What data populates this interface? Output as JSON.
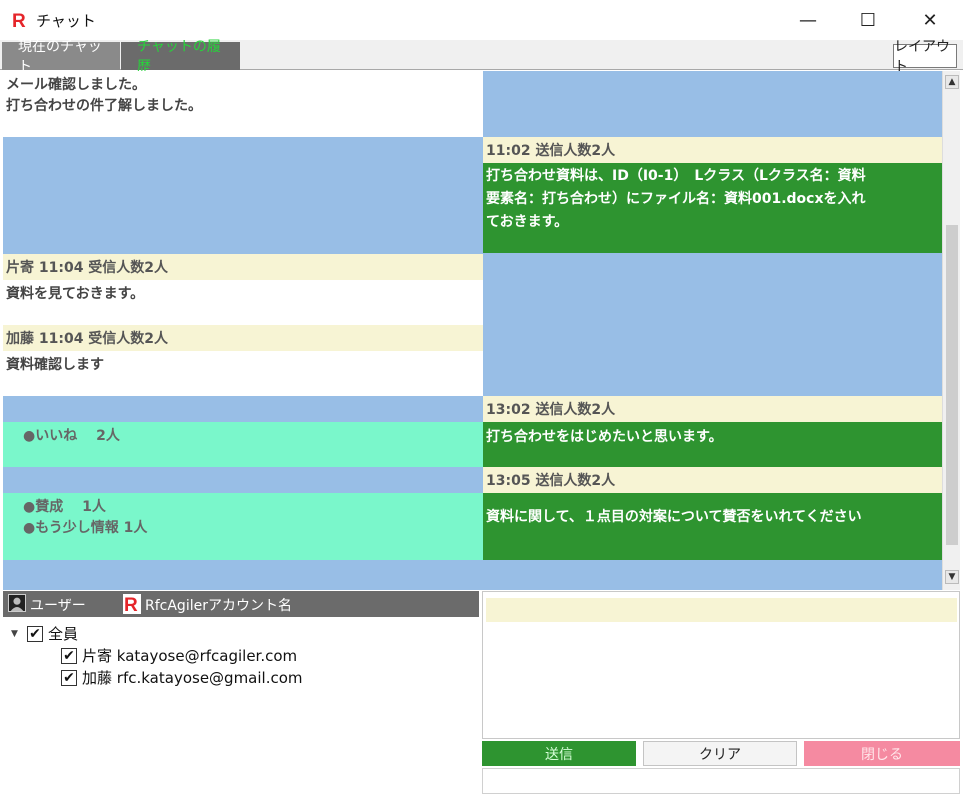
{
  "window": {
    "title": "チャット",
    "min_symbol": "—",
    "max_symbol": "☐",
    "close_symbol": "✕",
    "logo_letter": "R"
  },
  "tabs": [
    {
      "label": "現在のチャット"
    },
    {
      "label": "チャットの履歴"
    }
  ],
  "layout_button": "レイアウト",
  "messages": {
    "m1": {
      "lines": [
        "メール確認しました。",
        "打ち合わせの件了解しました。"
      ]
    },
    "m2": {
      "header": "11:02  送信人数2人",
      "lines": [
        "打ち合わせ資料は、ID（I0-1）　Lクラス（Lクラス名：資料",
        "要素名：打ち合わせ）にファイル名：資料001.docxを入れ",
        "ておきます。"
      ]
    },
    "m3": {
      "header": "片寄  11:04  受信人数2人",
      "lines": [
        "資料を見ておきます。"
      ]
    },
    "m4": {
      "header": "加藤  11:04  受信人数2人",
      "lines": [
        "資料確認します"
      ]
    },
    "m5": {
      "header": "13:02  送信人数2人",
      "lines": [
        "打ち合わせをはじめたいと思います。"
      ],
      "reactions": [
        "●いいね　 2人"
      ]
    },
    "m6": {
      "header": "13:05  送信人数2人",
      "lines": [
        "資料に関して、１点目の対案について賛否をいれてください"
      ],
      "reactions": [
        "●賛成　 1人",
        "●もう少し情報  1人"
      ]
    }
  },
  "users_panel": {
    "user_header": "ユーザー",
    "account_header": "RfcAgilerアカウント名",
    "all_label": "全員",
    "members": [
      {
        "name": "片寄",
        "email": "katayose@rfcagiler.com"
      },
      {
        "name": "加藤",
        "email": "rfc.katayose@gmail.com"
      }
    ]
  },
  "input": {
    "value": "",
    "placeholder": ""
  },
  "buttons": {
    "send": "送信",
    "clear": "クリア",
    "close": "閉じる"
  },
  "colors": {
    "sent_bubble": "#2e9430",
    "received_bubble": "#ffffff",
    "header_band": "#f7f4d4",
    "reaction": "#7af7cb",
    "chat_bg": "#98bee6",
    "close_button": "#f58aa1"
  }
}
